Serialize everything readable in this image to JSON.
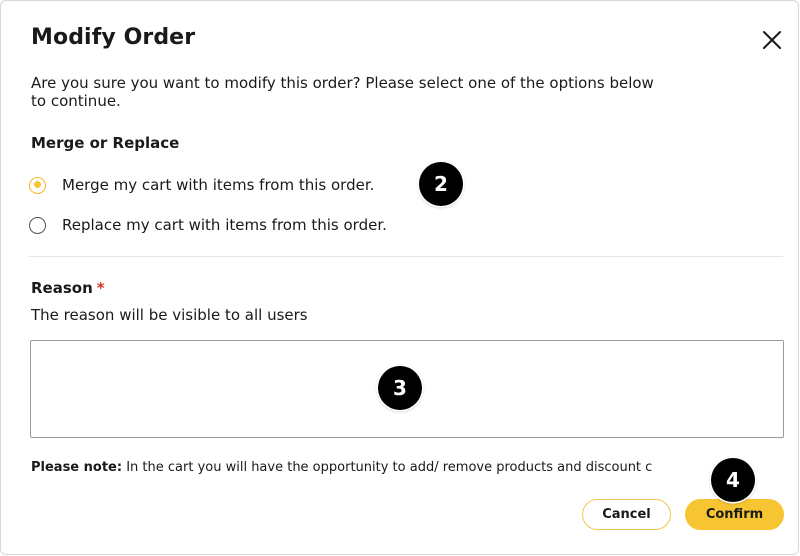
{
  "dialog": {
    "title": "Modify Order",
    "close_icon": "close-icon",
    "intro_line1": "Are you sure you want to modify this order? Please select one of the options below",
    "intro_line2": "to continue."
  },
  "merge_section": {
    "label": "Merge or Replace",
    "options": [
      {
        "label": "Merge my cart with items from this order.",
        "selected": true
      },
      {
        "label": "Replace my cart with items from this order.",
        "selected": false
      }
    ]
  },
  "reason": {
    "label": "Reason",
    "required_mark": "*",
    "help": "The reason will be visible to all users",
    "value": ""
  },
  "note": {
    "bold": "Please note:",
    "text": " In the cart you will have the opportunity to add/ remove products and discount c"
  },
  "buttons": {
    "cancel": "Cancel",
    "confirm": "Confirm"
  },
  "markers": {
    "m2": "2",
    "m3": "3",
    "m4": "4"
  },
  "colors": {
    "accent": "#f7c531",
    "required": "#d93025",
    "marker_bg": "#000000"
  }
}
